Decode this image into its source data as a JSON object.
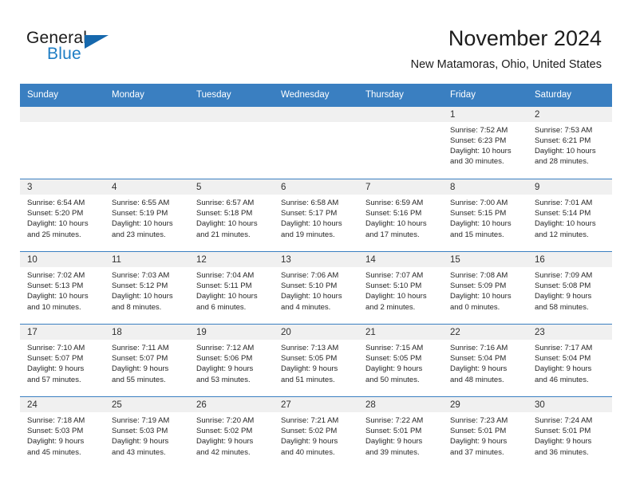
{
  "brand": {
    "word_one": "General",
    "word_two": "Blue",
    "flag_icon": "triangle-flag-icon"
  },
  "header": {
    "title": "November 2024",
    "subtitle": "New Matamoras, Ohio, United States"
  },
  "colors": {
    "header_blue": "#3a7fc1",
    "brand_blue": "#1d7dc4",
    "daynum_band": "#f0f0f0",
    "text": "#262626"
  },
  "calendar": {
    "weekday_headers": [
      "Sunday",
      "Monday",
      "Tuesday",
      "Wednesday",
      "Thursday",
      "Friday",
      "Saturday"
    ],
    "weeks": [
      [
        {
          "blank": true
        },
        {
          "blank": true
        },
        {
          "blank": true
        },
        {
          "blank": true
        },
        {
          "blank": true
        },
        {
          "day": "1",
          "sunrise": "Sunrise: 7:52 AM",
          "sunset": "Sunset: 6:23 PM",
          "daylight_line1": "Daylight: 10 hours",
          "daylight_line2": "and 30 minutes."
        },
        {
          "day": "2",
          "sunrise": "Sunrise: 7:53 AM",
          "sunset": "Sunset: 6:21 PM",
          "daylight_line1": "Daylight: 10 hours",
          "daylight_line2": "and 28 minutes."
        }
      ],
      [
        {
          "day": "3",
          "sunrise": "Sunrise: 6:54 AM",
          "sunset": "Sunset: 5:20 PM",
          "daylight_line1": "Daylight: 10 hours",
          "daylight_line2": "and 25 minutes."
        },
        {
          "day": "4",
          "sunrise": "Sunrise: 6:55 AM",
          "sunset": "Sunset: 5:19 PM",
          "daylight_line1": "Daylight: 10 hours",
          "daylight_line2": "and 23 minutes."
        },
        {
          "day": "5",
          "sunrise": "Sunrise: 6:57 AM",
          "sunset": "Sunset: 5:18 PM",
          "daylight_line1": "Daylight: 10 hours",
          "daylight_line2": "and 21 minutes."
        },
        {
          "day": "6",
          "sunrise": "Sunrise: 6:58 AM",
          "sunset": "Sunset: 5:17 PM",
          "daylight_line1": "Daylight: 10 hours",
          "daylight_line2": "and 19 minutes."
        },
        {
          "day": "7",
          "sunrise": "Sunrise: 6:59 AM",
          "sunset": "Sunset: 5:16 PM",
          "daylight_line1": "Daylight: 10 hours",
          "daylight_line2": "and 17 minutes."
        },
        {
          "day": "8",
          "sunrise": "Sunrise: 7:00 AM",
          "sunset": "Sunset: 5:15 PM",
          "daylight_line1": "Daylight: 10 hours",
          "daylight_line2": "and 15 minutes."
        },
        {
          "day": "9",
          "sunrise": "Sunrise: 7:01 AM",
          "sunset": "Sunset: 5:14 PM",
          "daylight_line1": "Daylight: 10 hours",
          "daylight_line2": "and 12 minutes."
        }
      ],
      [
        {
          "day": "10",
          "sunrise": "Sunrise: 7:02 AM",
          "sunset": "Sunset: 5:13 PM",
          "daylight_line1": "Daylight: 10 hours",
          "daylight_line2": "and 10 minutes."
        },
        {
          "day": "11",
          "sunrise": "Sunrise: 7:03 AM",
          "sunset": "Sunset: 5:12 PM",
          "daylight_line1": "Daylight: 10 hours",
          "daylight_line2": "and 8 minutes."
        },
        {
          "day": "12",
          "sunrise": "Sunrise: 7:04 AM",
          "sunset": "Sunset: 5:11 PM",
          "daylight_line1": "Daylight: 10 hours",
          "daylight_line2": "and 6 minutes."
        },
        {
          "day": "13",
          "sunrise": "Sunrise: 7:06 AM",
          "sunset": "Sunset: 5:10 PM",
          "daylight_line1": "Daylight: 10 hours",
          "daylight_line2": "and 4 minutes."
        },
        {
          "day": "14",
          "sunrise": "Sunrise: 7:07 AM",
          "sunset": "Sunset: 5:10 PM",
          "daylight_line1": "Daylight: 10 hours",
          "daylight_line2": "and 2 minutes."
        },
        {
          "day": "15",
          "sunrise": "Sunrise: 7:08 AM",
          "sunset": "Sunset: 5:09 PM",
          "daylight_line1": "Daylight: 10 hours",
          "daylight_line2": "and 0 minutes."
        },
        {
          "day": "16",
          "sunrise": "Sunrise: 7:09 AM",
          "sunset": "Sunset: 5:08 PM",
          "daylight_line1": "Daylight: 9 hours",
          "daylight_line2": "and 58 minutes."
        }
      ],
      [
        {
          "day": "17",
          "sunrise": "Sunrise: 7:10 AM",
          "sunset": "Sunset: 5:07 PM",
          "daylight_line1": "Daylight: 9 hours",
          "daylight_line2": "and 57 minutes."
        },
        {
          "day": "18",
          "sunrise": "Sunrise: 7:11 AM",
          "sunset": "Sunset: 5:07 PM",
          "daylight_line1": "Daylight: 9 hours",
          "daylight_line2": "and 55 minutes."
        },
        {
          "day": "19",
          "sunrise": "Sunrise: 7:12 AM",
          "sunset": "Sunset: 5:06 PM",
          "daylight_line1": "Daylight: 9 hours",
          "daylight_line2": "and 53 minutes."
        },
        {
          "day": "20",
          "sunrise": "Sunrise: 7:13 AM",
          "sunset": "Sunset: 5:05 PM",
          "daylight_line1": "Daylight: 9 hours",
          "daylight_line2": "and 51 minutes."
        },
        {
          "day": "21",
          "sunrise": "Sunrise: 7:15 AM",
          "sunset": "Sunset: 5:05 PM",
          "daylight_line1": "Daylight: 9 hours",
          "daylight_line2": "and 50 minutes."
        },
        {
          "day": "22",
          "sunrise": "Sunrise: 7:16 AM",
          "sunset": "Sunset: 5:04 PM",
          "daylight_line1": "Daylight: 9 hours",
          "daylight_line2": "and 48 minutes."
        },
        {
          "day": "23",
          "sunrise": "Sunrise: 7:17 AM",
          "sunset": "Sunset: 5:04 PM",
          "daylight_line1": "Daylight: 9 hours",
          "daylight_line2": "and 46 minutes."
        }
      ],
      [
        {
          "day": "24",
          "sunrise": "Sunrise: 7:18 AM",
          "sunset": "Sunset: 5:03 PM",
          "daylight_line1": "Daylight: 9 hours",
          "daylight_line2": "and 45 minutes."
        },
        {
          "day": "25",
          "sunrise": "Sunrise: 7:19 AM",
          "sunset": "Sunset: 5:03 PM",
          "daylight_line1": "Daylight: 9 hours",
          "daylight_line2": "and 43 minutes."
        },
        {
          "day": "26",
          "sunrise": "Sunrise: 7:20 AM",
          "sunset": "Sunset: 5:02 PM",
          "daylight_line1": "Daylight: 9 hours",
          "daylight_line2": "and 42 minutes."
        },
        {
          "day": "27",
          "sunrise": "Sunrise: 7:21 AM",
          "sunset": "Sunset: 5:02 PM",
          "daylight_line1": "Daylight: 9 hours",
          "daylight_line2": "and 40 minutes."
        },
        {
          "day": "28",
          "sunrise": "Sunrise: 7:22 AM",
          "sunset": "Sunset: 5:01 PM",
          "daylight_line1": "Daylight: 9 hours",
          "daylight_line2": "and 39 minutes."
        },
        {
          "day": "29",
          "sunrise": "Sunrise: 7:23 AM",
          "sunset": "Sunset: 5:01 PM",
          "daylight_line1": "Daylight: 9 hours",
          "daylight_line2": "and 37 minutes."
        },
        {
          "day": "30",
          "sunrise": "Sunrise: 7:24 AM",
          "sunset": "Sunset: 5:01 PM",
          "daylight_line1": "Daylight: 9 hours",
          "daylight_line2": "and 36 minutes."
        }
      ]
    ]
  }
}
